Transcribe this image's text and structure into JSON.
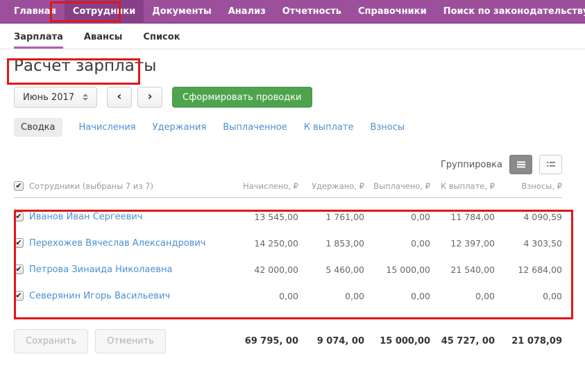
{
  "colors": {
    "topnav_purple": "#9c509c",
    "topnav_active_purple": "#873f87",
    "annotation_red": "#e01717",
    "button_green": "#4da44d",
    "link_blue": "#4a90d2"
  },
  "topnav": {
    "items": [
      {
        "label": "Главная"
      },
      {
        "label": "Сотрудники"
      },
      {
        "label": "Документы"
      },
      {
        "label": "Анализ"
      },
      {
        "label": "Отчетность"
      },
      {
        "label": "Справочники"
      },
      {
        "label": "Поиск по законодательству"
      }
    ]
  },
  "subnav": {
    "items": [
      {
        "label": "Зарплата"
      },
      {
        "label": "Авансы"
      },
      {
        "label": "Список"
      }
    ]
  },
  "page": {
    "title": "Расчет зарплаты"
  },
  "toolbar": {
    "period": "Июнь 2017",
    "prev": "‹",
    "next": "›",
    "generate_label": "Сформировать проводки"
  },
  "tabs": {
    "items": [
      {
        "label": "Сводка"
      },
      {
        "label": "Начисления"
      },
      {
        "label": "Удержания"
      },
      {
        "label": "Выплаченное"
      },
      {
        "label": "К выплате"
      },
      {
        "label": "Взносы"
      }
    ]
  },
  "table": {
    "grouping_label": "Группировка",
    "select_all_label": "Сотрудники (выбраны 7 из 7)",
    "columns": [
      "Начислено, ₽",
      "Удержано, ₽",
      "Выплачено, ₽",
      "К выплате, ₽",
      "Взносы, ₽"
    ],
    "rows": [
      {
        "name": "Иванов Иван Сергеевич",
        "values": [
          "13 545,00",
          "1 761,00",
          "0,00",
          "11 784,00",
          "4 090,59"
        ]
      },
      {
        "name": "Перехожев Вячеслав Александрович",
        "values": [
          "14 250,00",
          "1 853,00",
          "0,00",
          "12 397,00",
          "4 303,50"
        ]
      },
      {
        "name": "Петрова Зинаида Николаевна",
        "values": [
          "42 000,00",
          "5 460,00",
          "15 000,00",
          "21 540,00",
          "12 684,00"
        ]
      },
      {
        "name": "Северянин Игорь Васильевич",
        "values": [
          "0,00",
          "0,00",
          "0,00",
          "0,00",
          "0,00"
        ]
      }
    ],
    "totals": [
      "69 795, 00",
      "9 074, 00",
      "15 000,00",
      "45 727, 00",
      "21 078,09"
    ]
  },
  "footer": {
    "save_label": "Сохранить",
    "cancel_label": "Отменить"
  }
}
